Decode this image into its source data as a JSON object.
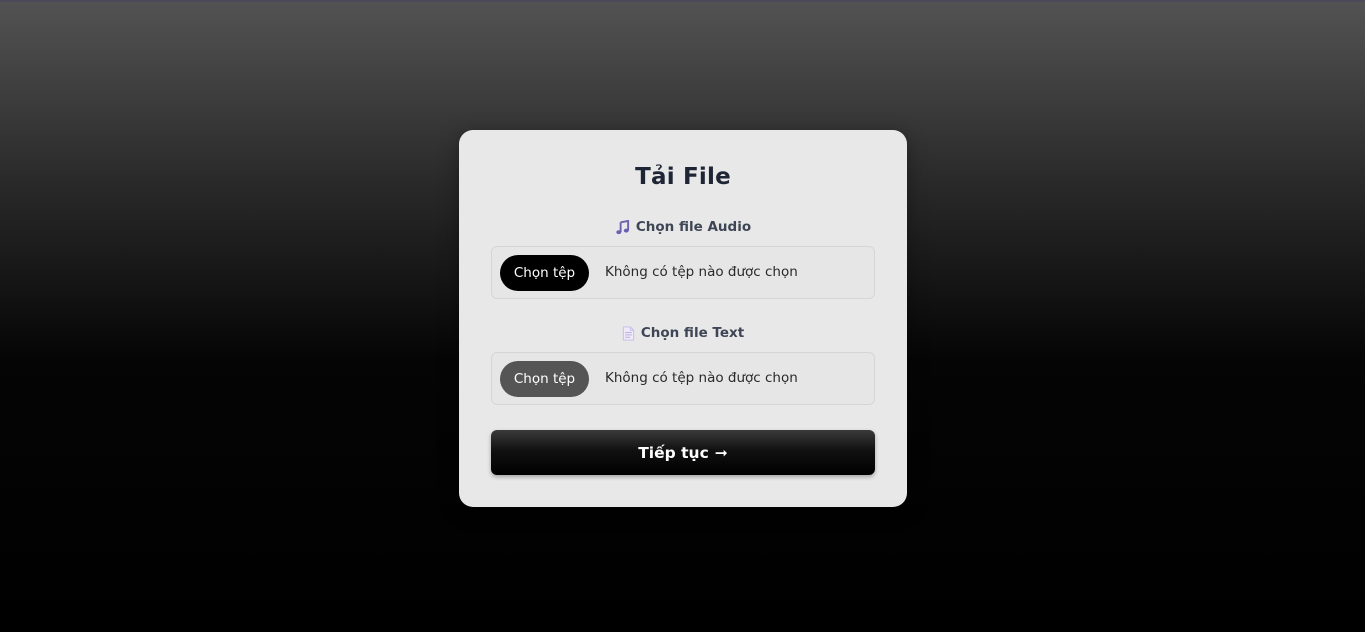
{
  "upload": {
    "title": "Tải File",
    "audio": {
      "label": "Chọn file Audio",
      "icon": "music-note-icon",
      "button_label": "Chọn tệp",
      "status": "Không có tệp nào được chọn"
    },
    "text": {
      "label": "Chọn file Text",
      "icon": "document-icon",
      "button_label": "Chọn tệp",
      "status": "Không có tệp nào được chọn"
    },
    "continue": {
      "label": "Tiếp tục",
      "arrow": "➞"
    }
  },
  "colors": {
    "title": "#1e2535",
    "card_background": "#e8e8e8",
    "audio_icon": "#6a5fb0",
    "text_icon": "#c9bce6",
    "primary_button": "#000000",
    "secondary_button": "#555555"
  }
}
